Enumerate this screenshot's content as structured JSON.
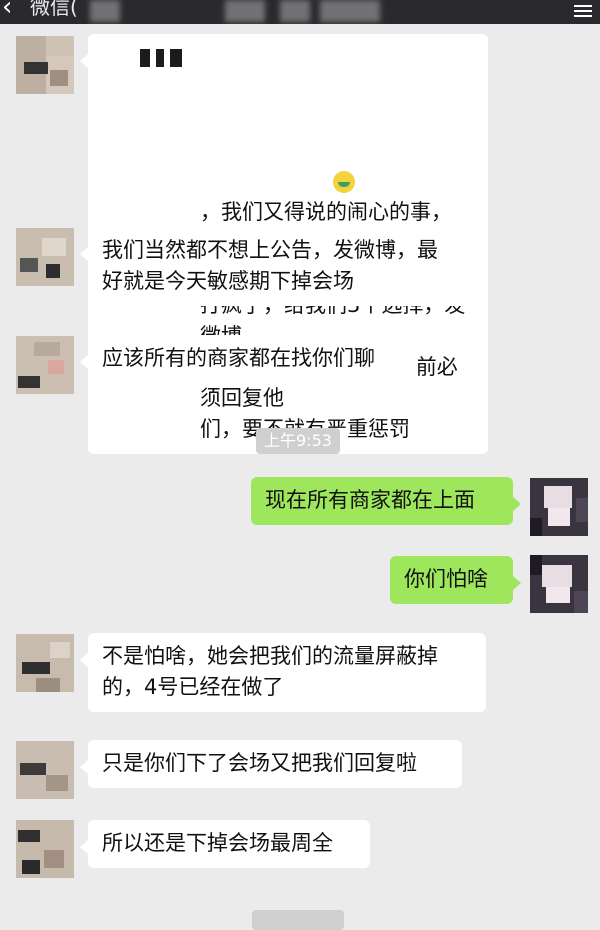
{
  "header": {
    "back_icon": "chevron-left-icon",
    "title": "微信(",
    "menu_icon": "more-icon"
  },
  "messages": [
    {
      "side": "in",
      "text": "，我们又得说的闹心的事，\n今天先安排会场都撤掉呗，天猫真的\n打疯了，给我们3个选择，发微博，\n上公告，下会场，10点前必须回复他\n们，要不就有严重惩罚"
    },
    {
      "side": "in",
      "text": "我们当然都不想上公告，发微博，最\n好就是今天敏感期下掉会场"
    },
    {
      "side": "in",
      "text": "应该所有的商家都在找你们聊"
    },
    {
      "side": "time",
      "text": "上午9:53"
    },
    {
      "side": "out",
      "text": "现在所有商家都在上面"
    },
    {
      "side": "out",
      "text": "你们怕啥"
    },
    {
      "side": "in",
      "text": "不是怕啥，她会把我们的流量屏蔽掉\n的，4号已经在做了"
    },
    {
      "side": "in",
      "text": "只是你们下了会场又把我们回复啦"
    },
    {
      "side": "in",
      "text": "所以还是下掉会场最周全"
    }
  ],
  "colors": {
    "background": "#ebebeb",
    "incoming_bubble": "#ffffff",
    "outgoing_bubble": "#9ee65c",
    "timestamp_bg": "#cfcfcf"
  },
  "emoji": "crying-face-emoji"
}
